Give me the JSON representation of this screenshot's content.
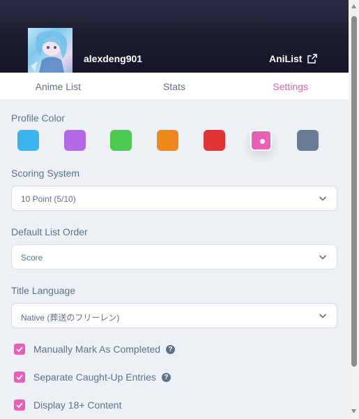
{
  "profile": {
    "username": "alexdeng901",
    "site_link_label": "AniList"
  },
  "tabs": [
    {
      "label": "Anime List",
      "active": false
    },
    {
      "label": "Stats",
      "active": false
    },
    {
      "label": "Settings",
      "active": true
    }
  ],
  "settings": {
    "profile_color": {
      "label": "Profile Color",
      "options": [
        "#3db4f2",
        "#b368e6",
        "#4cca51",
        "#ef881a",
        "#e13333",
        "#e85fb5",
        "#677b94"
      ],
      "selected_index": 5
    },
    "scoring_system": {
      "label": "Scoring System",
      "value": "10 Point (5/10)"
    },
    "default_list_order": {
      "label": "Default List Order",
      "value": "Score"
    },
    "title_language": {
      "label": "Title Language",
      "value": "Native (葬送のフリーレン)"
    },
    "checkboxes": [
      {
        "label": "Manually Mark As Completed",
        "checked": true,
        "help": true
      },
      {
        "label": "Separate Caught-Up Entries",
        "checked": true,
        "help": true
      },
      {
        "label": "Display 18+ Content",
        "checked": true,
        "help": false
      }
    ]
  },
  "icons": {
    "external_link": "external-link-icon",
    "chevron": "chevron-down-icon",
    "check": "check-icon",
    "help": "question-icon"
  },
  "help_glyph": "?",
  "theme": {
    "accent": "#e85fb5",
    "text_muted": "#5c728a",
    "header_bg": "#1b1c30",
    "page_bg": "#edf1f5"
  }
}
